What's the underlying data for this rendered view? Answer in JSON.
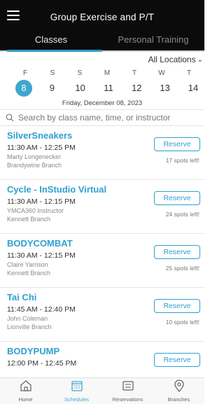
{
  "header": {
    "title": "Group Exercise and P/T"
  },
  "tabs": [
    {
      "label": "Classes",
      "active": true
    },
    {
      "label": "Personal Training",
      "active": false
    }
  ],
  "location_filter": {
    "label": "All Locations"
  },
  "calendar": {
    "weekdays": [
      "F",
      "S",
      "S",
      "M",
      "T",
      "W",
      "T"
    ],
    "dates": [
      "8",
      "9",
      "10",
      "11",
      "12",
      "13",
      "14"
    ],
    "selected_index": 0,
    "selected_label": "Friday, December 08, 2023"
  },
  "search": {
    "placeholder": "Search by class name, time, or instructor"
  },
  "classes": [
    {
      "name": "SilverSneakers",
      "time": "11:30 AM - 12:25 PM",
      "instructor": "Marty Longenecker",
      "branch": "Brandywine Branch",
      "reserve_label": "Reserve",
      "spots": "17 spots left!"
    },
    {
      "name": "Cycle - InStudio Virtual",
      "time": "11:30 AM - 12:15 PM",
      "instructor": "YMCA360 Instructor",
      "branch": "Kennett Branch",
      "reserve_label": "Reserve",
      "spots": "24 spots left!"
    },
    {
      "name": "BODYCOMBAT",
      "time": "11:30 AM - 12:15 PM",
      "instructor": "Claire Yarrison",
      "branch": "Kennett Branch",
      "reserve_label": "Reserve",
      "spots": "25 spots left!"
    },
    {
      "name": "Tai Chi",
      "time": "11:45 AM - 12:40 PM",
      "instructor": "John Coleman",
      "branch": "Lionville Branch",
      "reserve_label": "Reserve",
      "spots": "10 spots left!"
    },
    {
      "name": "BODYPUMP",
      "time": "12:00 PM - 12:45 PM",
      "instructor": "",
      "branch": "",
      "reserve_label": "Reserve",
      "spots": ""
    }
  ],
  "bottom_nav": [
    {
      "label": "Home",
      "icon": "home-icon",
      "active": false
    },
    {
      "label": "Schedules",
      "icon": "calendar-icon",
      "active": true
    },
    {
      "label": "Reservations",
      "icon": "reservation-icon",
      "active": false
    },
    {
      "label": "Branches",
      "icon": "location-pin-icon",
      "active": false
    }
  ],
  "colors": {
    "accent": "#2f9fcf",
    "selected_date": "#3fa7cf",
    "header_bg": "#0b0b0b"
  }
}
